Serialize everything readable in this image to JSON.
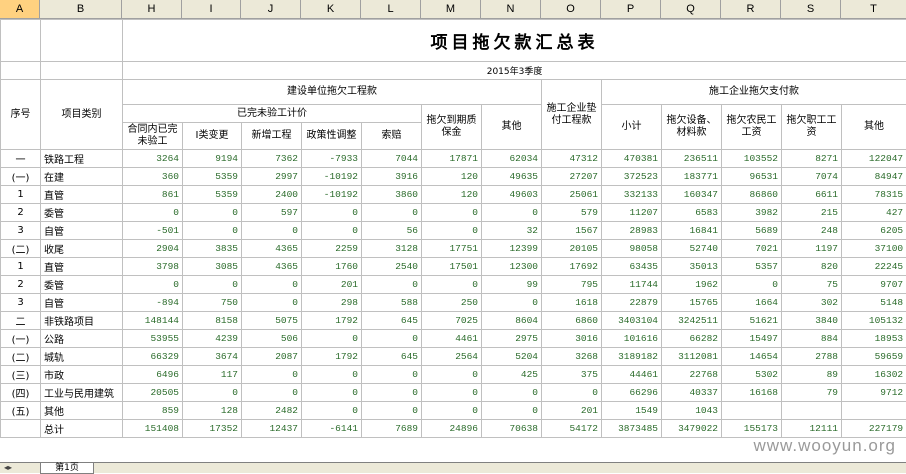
{
  "column_headers": [
    "A",
    "B",
    "H",
    "I",
    "J",
    "K",
    "L",
    "M",
    "N",
    "O",
    "P",
    "Q",
    "R",
    "S",
    "T"
  ],
  "title": "项目拖欠款汇总表",
  "period": "2015年3季度",
  "headers": {
    "seq": "序号",
    "category": "项目类别",
    "group_a": "建设单位拖欠工程款",
    "group_a_sub": "已完未验工计价",
    "h_contract": "合同内已完未验工",
    "h_typeI": "I类变更",
    "h_new": "新增工程",
    "h_policy": "政策性调整",
    "h_claim": "索赔",
    "h_due": "拖欠到期质保金",
    "h_other_a": "其他",
    "h_advance": "施工企业垫付工程款",
    "group_b": "施工企业拖欠支付款",
    "h_subtotal": "小计",
    "h_equipment": "拖欠设备、材料款",
    "h_migrant": "拖欠农民工工资",
    "h_staff": "拖欠职工工资",
    "h_other_b": "其他"
  },
  "rows": [
    {
      "seq": "一",
      "name": "铁路工程",
      "v": [
        "3264",
        "9194",
        "7362",
        "-7933",
        "7044",
        "17871",
        "62034",
        "47312",
        "470381",
        "236511",
        "103552",
        "8271",
        "122047"
      ]
    },
    {
      "seq": "(一)",
      "name": "在建",
      "v": [
        "360",
        "5359",
        "2997",
        "-10192",
        "3916",
        "120",
        "49635",
        "27207",
        "372523",
        "183771",
        "96531",
        "7074",
        "84947"
      ]
    },
    {
      "seq": "1",
      "name": "直管",
      "v": [
        "861",
        "5359",
        "2400",
        "-10192",
        "3860",
        "120",
        "49603",
        "25061",
        "332133",
        "160347",
        "86860",
        "6611",
        "78315"
      ]
    },
    {
      "seq": "2",
      "name": "委管",
      "v": [
        "0",
        "0",
        "597",
        "0",
        "0",
        "0",
        "0",
        "579",
        "11207",
        "6583",
        "3982",
        "215",
        "427"
      ]
    },
    {
      "seq": "3",
      "name": "自管",
      "v": [
        "-501",
        "0",
        "0",
        "0",
        "56",
        "0",
        "32",
        "1567",
        "28983",
        "16841",
        "5689",
        "248",
        "6205"
      ]
    },
    {
      "seq": "(二)",
      "name": "收尾",
      "v": [
        "2904",
        "3835",
        "4365",
        "2259",
        "3128",
        "17751",
        "12399",
        "20105",
        "98058",
        "52740",
        "7021",
        "1197",
        "37100"
      ]
    },
    {
      "seq": "1",
      "name": "直管",
      "v": [
        "3798",
        "3085",
        "4365",
        "1760",
        "2540",
        "17501",
        "12300",
        "17692",
        "63435",
        "35013",
        "5357",
        "820",
        "22245"
      ]
    },
    {
      "seq": "2",
      "name": "委管",
      "v": [
        "0",
        "0",
        "0",
        "201",
        "0",
        "0",
        "99",
        "795",
        "11744",
        "1962",
        "0",
        "75",
        "9707"
      ]
    },
    {
      "seq": "3",
      "name": "自管",
      "v": [
        "-894",
        "750",
        "0",
        "298",
        "588",
        "250",
        "0",
        "1618",
        "22879",
        "15765",
        "1664",
        "302",
        "5148"
      ]
    },
    {
      "seq": "二",
      "name": "非铁路项目",
      "v": [
        "148144",
        "8158",
        "5075",
        "1792",
        "645",
        "7025",
        "8604",
        "6860",
        "3403104",
        "3242511",
        "51621",
        "3840",
        "105132"
      ]
    },
    {
      "seq": "(一)",
      "name": "公路",
      "v": [
        "53955",
        "4239",
        "506",
        "0",
        "0",
        "4461",
        "2975",
        "3016",
        "101616",
        "66282",
        "15497",
        "884",
        "18953"
      ]
    },
    {
      "seq": "(二)",
      "name": "城轨",
      "v": [
        "66329",
        "3674",
        "2087",
        "1792",
        "645",
        "2564",
        "5204",
        "3268",
        "3189182",
        "3112081",
        "14654",
        "2788",
        "59659"
      ]
    },
    {
      "seq": "(三)",
      "name": "市政",
      "v": [
        "6496",
        "117",
        "0",
        "0",
        "0",
        "0",
        "425",
        "375",
        "44461",
        "22768",
        "5302",
        "89",
        "16302"
      ]
    },
    {
      "seq": "(四)",
      "name": "工业与民用建筑",
      "v": [
        "20505",
        "0",
        "0",
        "0",
        "0",
        "0",
        "0",
        "0",
        "66296",
        "40337",
        "16168",
        "79",
        "9712"
      ]
    },
    {
      "seq": "(五)",
      "name": "其他",
      "v": [
        "859",
        "128",
        "2482",
        "0",
        "0",
        "0",
        "0",
        "201",
        "1549",
        "1043",
        "",
        "",
        ""
      ]
    },
    {
      "seq": "",
      "name": "总计",
      "v": [
        "151408",
        "17352",
        "12437",
        "-6141",
        "7689",
        "24896",
        "70638",
        "54172",
        "3873485",
        "3479022",
        "155173",
        "12111",
        "227179"
      ]
    }
  ],
  "sheet_tab": "第1页",
  "watermark": "www.wooyun.org",
  "colors": {
    "header_bg": "#ece9d8",
    "value_text": "#2a6b2a",
    "selected_header": "#ffd180"
  }
}
